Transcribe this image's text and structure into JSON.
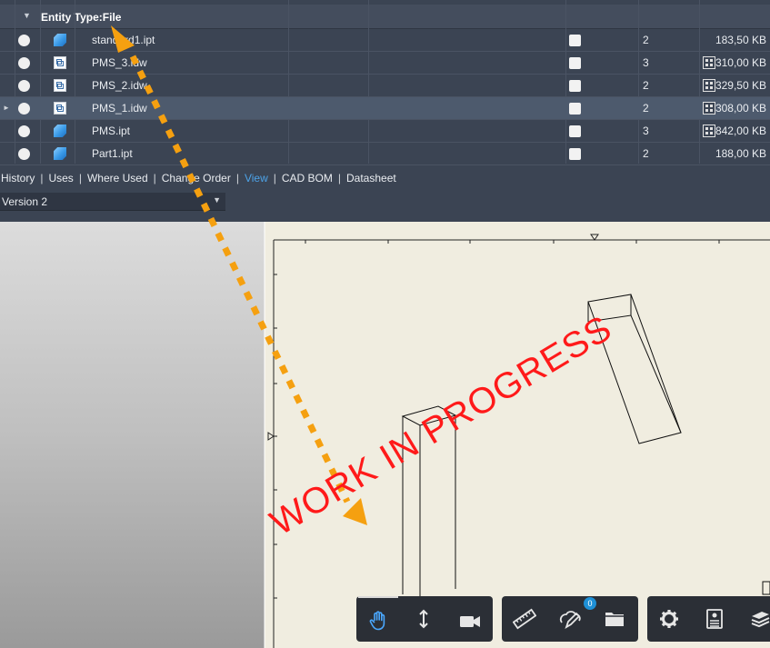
{
  "grid": {
    "group_label": "Entity Type:File",
    "rows": [
      {
        "name": "standard1.ipt",
        "type": "ipt",
        "revision": "2",
        "has_thumb": false,
        "size": "183,50 KB",
        "selected": false
      },
      {
        "name": "PMS_3.idw",
        "type": "idw",
        "revision": "3",
        "has_thumb": true,
        "size": "310,00 KB",
        "selected": false
      },
      {
        "name": "PMS_2.idw",
        "type": "idw",
        "revision": "2",
        "has_thumb": true,
        "size": "329,50 KB",
        "selected": false
      },
      {
        "name": "PMS_1.idw",
        "type": "idw",
        "revision": "2",
        "has_thumb": true,
        "size": "308,00 KB",
        "selected": true
      },
      {
        "name": "PMS.ipt",
        "type": "ipt",
        "revision": "3",
        "has_thumb": true,
        "size": "842,00 KB",
        "selected": false
      },
      {
        "name": "Part1.ipt",
        "type": "ipt",
        "revision": "2",
        "has_thumb": false,
        "size": "188,00 KB",
        "selected": false
      }
    ]
  },
  "tabs": {
    "items": [
      "History",
      "Uses",
      "Where Used",
      "Change Order",
      "View",
      "CAD BOM",
      "Datasheet"
    ],
    "active": "View"
  },
  "version": {
    "selected": "Version 2"
  },
  "toolbar": {
    "markup_count": "0",
    "groups": [
      [
        "pan-icon",
        "zoom-icon",
        "camera-icon"
      ],
      [
        "measure-icon",
        "markup-icon",
        "folder-icon"
      ],
      [
        "settings-icon",
        "properties-icon",
        "layers-icon"
      ]
    ]
  },
  "overlay": {
    "stamp_text": "WORK IN PROGRESS"
  },
  "colors": {
    "panel": "#3b4453",
    "selected_row": "#4d5a6d",
    "active_tab": "#4da3e8",
    "sheet": "#f0ede0",
    "stamp": "#ff1a1a",
    "annotation_arrow": "#f5a010"
  }
}
